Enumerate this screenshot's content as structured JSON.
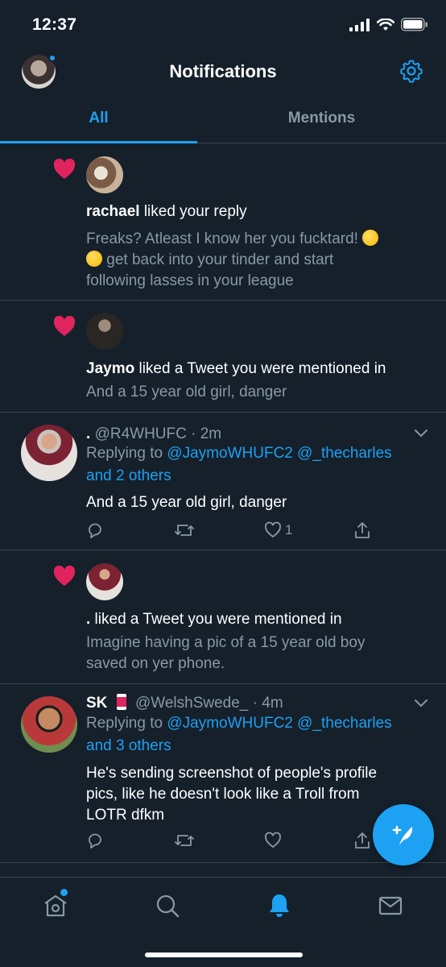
{
  "status_bar": {
    "time": "12:37"
  },
  "header": {
    "title": "Notifications"
  },
  "tabs": [
    {
      "label": "All",
      "active": true
    },
    {
      "label": "Mentions",
      "active": false
    }
  ],
  "notifications": [
    {
      "type": "like",
      "user": "rachael",
      "action": " liked your reply",
      "text_line1": "Freaks? Atleast I know her you fucktard!",
      "text_line2": "get back into your tinder and start",
      "text_line3": "following lasses in your league"
    },
    {
      "type": "like",
      "user": "Jaymo",
      "action": " liked a Tweet you were mentioned in",
      "text_line1": "And a 15 year old girl, danger"
    },
    {
      "type": "tweet",
      "name": ".",
      "handle": "@R4WHUFC",
      "time": "· 2m",
      "replying_prefix": "Replying to ",
      "replying_users": "@JaymoWHUFC2 @_thecharles",
      "replying_others": "and 2 others",
      "text": "And a 15 year old girl, danger",
      "likes": "1"
    },
    {
      "type": "like",
      "user": ".",
      "action": " liked a Tweet you were mentioned in",
      "text_line1": "Imagine having a pic of a 15 year old boy",
      "text_line2": "saved on yer phone."
    },
    {
      "type": "tweet",
      "name": "SK",
      "handle": "@WelshSwede_",
      "time": "· 4m",
      "replying_prefix": "Replying to ",
      "replying_users": "@JaymoWHUFC2 @_thecharles",
      "replying_others": "and 3 others",
      "text_line1": "He's sending screenshot of people's profile",
      "text_line2": "pics, like he doesn't look like a Troll from",
      "text_line3": "LOTR dfkm"
    }
  ],
  "colors": {
    "accent": "#1da1f2",
    "background": "#15202b",
    "heart": "#e0245e",
    "muted": "#8899a6"
  },
  "icons": [
    "gear-icon",
    "heart-icon",
    "reply-icon",
    "retweet-icon",
    "like-icon",
    "share-icon",
    "compose-icon",
    "home-icon",
    "search-icon",
    "bell-icon",
    "mail-icon"
  ]
}
